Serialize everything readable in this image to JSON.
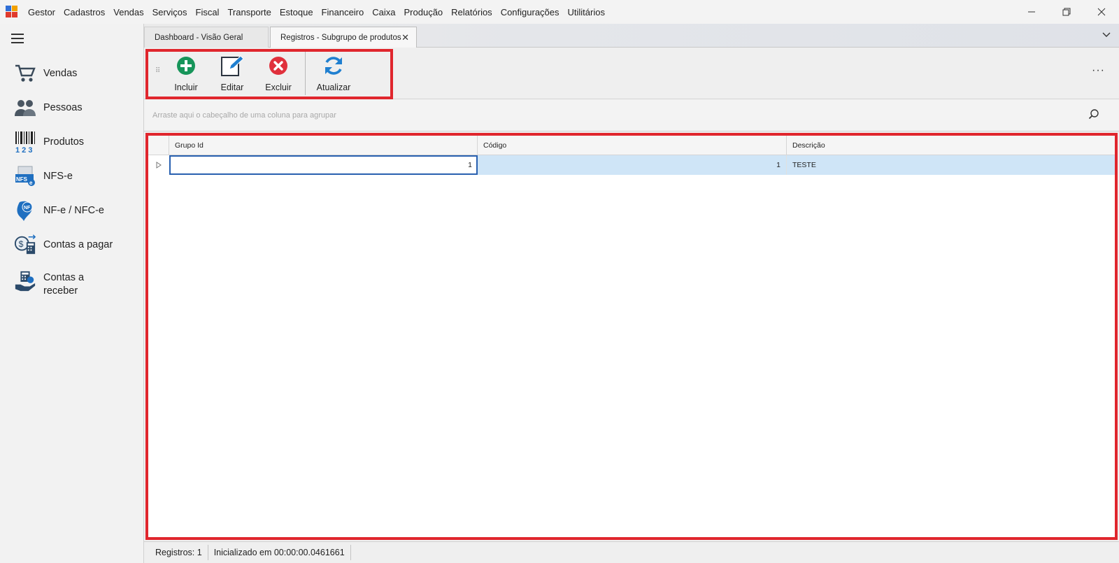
{
  "menu": [
    "Gestor",
    "Cadastros",
    "Vendas",
    "Serviços",
    "Fiscal",
    "Transporte",
    "Estoque",
    "Financeiro",
    "Caixa",
    "Produção",
    "Relatórios",
    "Configurações",
    "Utilitários"
  ],
  "window_controls": {
    "minimize": "—",
    "restore": "❐",
    "close": "✕"
  },
  "sidebar": {
    "items": [
      {
        "label": "Vendas",
        "icon": "cart-icon"
      },
      {
        "label": "Pessoas",
        "icon": "people-icon"
      },
      {
        "label": "Produtos",
        "icon": "barcode-icon"
      },
      {
        "label": "NFS-e",
        "icon": "nfse-icon"
      },
      {
        "label": "NF-e / NFC-e",
        "icon": "nfe-icon"
      },
      {
        "label": "Contas a pagar",
        "icon": "bill-pay-icon"
      },
      {
        "label": "Contas a receber",
        "icon": "bill-receive-icon"
      }
    ]
  },
  "tabs": [
    {
      "label": "Dashboard - Visão Geral"
    },
    {
      "label": "Registros - Subgrupo de produtos",
      "close": "✕"
    }
  ],
  "toolbar": {
    "buttons": [
      {
        "label": "Incluir",
        "icon": "add-icon"
      },
      {
        "label": "Editar",
        "icon": "edit-icon"
      },
      {
        "label": "Excluir",
        "icon": "delete-icon"
      },
      {
        "label": "Atualizar",
        "icon": "refresh-icon"
      }
    ],
    "more": "···"
  },
  "group_panel": {
    "hint": "Arraste aqui o cabeçalho de uma coluna para agrupar"
  },
  "grid": {
    "columns": [
      "Grupo Id",
      "Código",
      "Descrição"
    ],
    "rows": [
      {
        "grupo_id": "1",
        "codigo": "1",
        "descricao": "TESTE"
      }
    ]
  },
  "status": {
    "registros": "Registros: 1",
    "inicializado": "Inicializado em 00:00:00.0461661"
  },
  "colors": {
    "highlight_frame": "#e0262d",
    "selected_row": "#cfe5f7",
    "focus_cell_border": "#2860b0",
    "add": "#17955a",
    "delete": "#e0303c",
    "refresh": "#1f7fd0"
  }
}
